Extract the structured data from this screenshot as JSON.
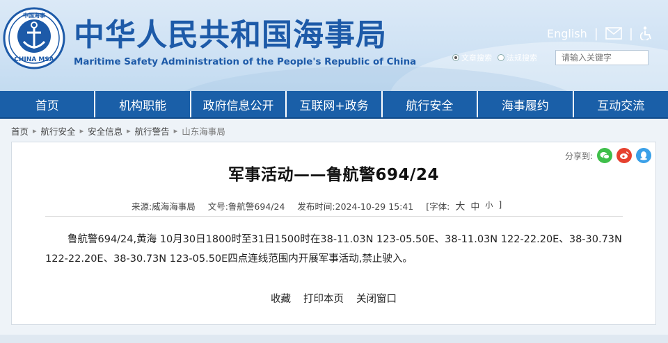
{
  "header": {
    "logo_text": "CHINA MSA",
    "logo_top_text": "中国海事",
    "title": "中华人民共和国海事局",
    "subtitle": "Maritime Safety Administration of the People's Republic of China",
    "english_link": "English",
    "separator": "|",
    "search_options": [
      "文章搜索",
      "法规搜索"
    ],
    "search_placeholder": "请输入关键字"
  },
  "nav": {
    "items": [
      "首页",
      "机构职能",
      "政府信息公开",
      "互联网+政务",
      "航行安全",
      "海事履约",
      "互动交流"
    ]
  },
  "breadcrumb": {
    "items": [
      "首页",
      "航行安全",
      "安全信息",
      "航行警告",
      "山东海事局"
    ]
  },
  "article": {
    "share_label": "分享到:",
    "title": "军事活动——鲁航警694/24",
    "source": "来源:威海海事局",
    "doc_no": "文号:鲁航警694/24",
    "publish_time": "发布时间:2024-10-29 15:41",
    "font_label": "[字体:",
    "font_large": "大",
    "font_medium": "中",
    "font_small": "小",
    "font_close": "]",
    "body": "鲁航警694/24,黄海 10月30日1800时至31日1500时在38-11.03N 123-05.50E、38-11.03N 122-22.20E、38-30.73N 122-22.20E、38-30.73N 123-05.50E四点连线范围内开展军事活动,禁止驶入。",
    "actions": [
      "收藏",
      "打印本页",
      "关闭窗口"
    ]
  },
  "colors": {
    "brand": "#1d5aa8",
    "nav_bg": "#1a5fa8",
    "wechat": "#3fbf4a",
    "weibo": "#e6412f",
    "qq": "#3aa0e8"
  }
}
